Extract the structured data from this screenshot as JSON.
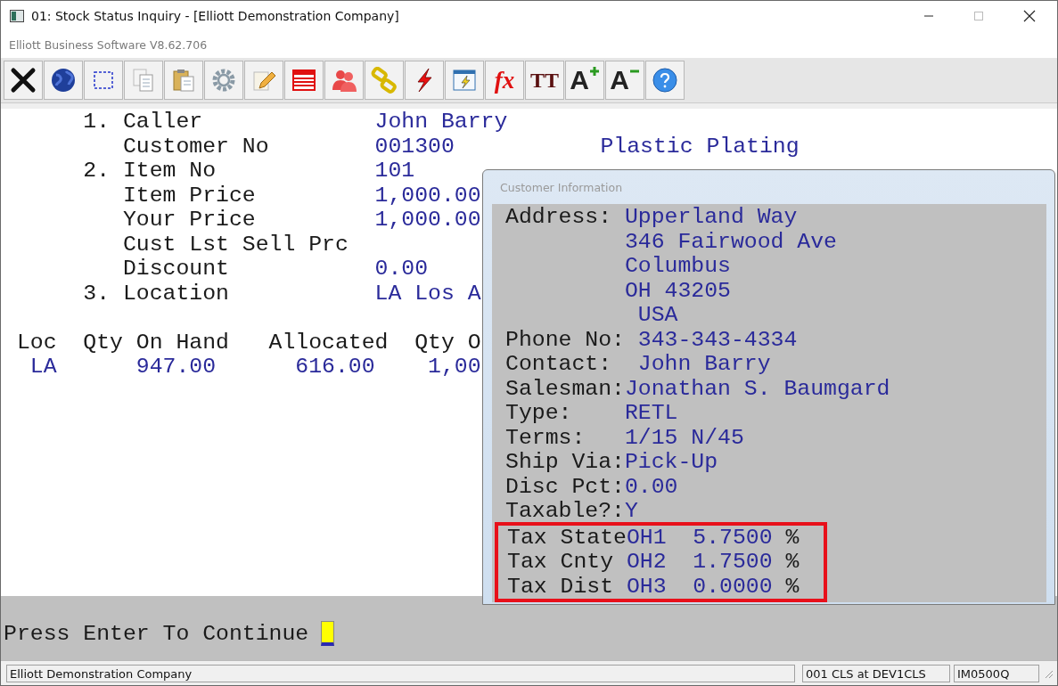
{
  "window": {
    "title": "01: Stock Status Inquiry - [Elliott Demonstration Company]",
    "subtitle": "Elliott Business Software V8.62.706"
  },
  "toolbar": [
    {
      "kind": "close"
    },
    {
      "kind": "globe"
    },
    {
      "kind": "select"
    },
    {
      "kind": "copy"
    },
    {
      "kind": "paste"
    },
    {
      "kind": "gear"
    },
    {
      "kind": "edit"
    },
    {
      "kind": "table"
    },
    {
      "kind": "users"
    },
    {
      "kind": "link"
    },
    {
      "kind": "lightning"
    },
    {
      "kind": "window"
    },
    {
      "kind": "formula",
      "text": "fx"
    },
    {
      "kind": "font",
      "text": "TT"
    },
    {
      "kind": "larger",
      "text": "A"
    },
    {
      "kind": "smaller",
      "text": "A"
    },
    {
      "kind": "help"
    }
  ],
  "form": [
    {
      "number": "1.",
      "label": "Caller",
      "value": "John Barry"
    },
    {
      "label": "Customer No",
      "value": "001300",
      "extra": "Plastic Plating"
    },
    {
      "number": "2.",
      "label": "Item No",
      "value": "101"
    },
    {
      "label": "Item Price",
      "value": "1,000.00"
    },
    {
      "label": "Your Price",
      "value": "1,000.00"
    },
    {
      "label": "Cust Lst Sell Prc"
    },
    {
      "label": "Discount",
      "value": "0.00"
    },
    {
      "number": "3.",
      "label": "Location",
      "value": "LA Los A"
    }
  ],
  "stock": {
    "columns": [
      "Loc",
      "Qty On Hand",
      "Allocated",
      "Qty O"
    ],
    "rows": [
      [
        "LA",
        "947.00",
        "616.00",
        "1,00"
      ]
    ]
  },
  "prompt": "Press Enter To Continue",
  "popup": {
    "title": "Customer Information",
    "lines": [
      {
        "label": "Address:",
        "value": "Upperland Way"
      },
      {
        "value": "346 Fairwood Ave"
      },
      {
        "value": "Columbus"
      },
      {
        "value": "OH  43205"
      },
      {
        "value": "USA"
      },
      {
        "label": "Phone No:",
        "value": "343-343-4334"
      },
      {
        "label": "Contact:",
        "value": "John Barry"
      },
      {
        "label": "Salesman:",
        "value": "Jonathan S. Baumgard"
      },
      {
        "label": "Type:",
        "value": "RETL"
      },
      {
        "label": "Terms:",
        "value": "1/15 N/45"
      },
      {
        "label": "Ship Via:",
        "value": "Pick-Up"
      },
      {
        "label": "Disc Pct:",
        "value": "0.00"
      },
      {
        "label": "Taxable?:",
        "value": "Y"
      }
    ],
    "tax_highlighted": true,
    "taxes": [
      {
        "label": "Tax State",
        "code": "OH1",
        "rate": "5.7500",
        "unit": "%"
      },
      {
        "label": "Tax Cnty",
        "code": "OH2",
        "rate": "1.7500",
        "unit": "%"
      },
      {
        "label": "Tax Dist",
        "code": "OH3",
        "rate": "0.0000",
        "unit": "%"
      }
    ]
  },
  "status_bar": [
    "Elliott Demonstration Company",
    "001 CLS at DEV1CLS",
    "IM0500Q"
  ]
}
